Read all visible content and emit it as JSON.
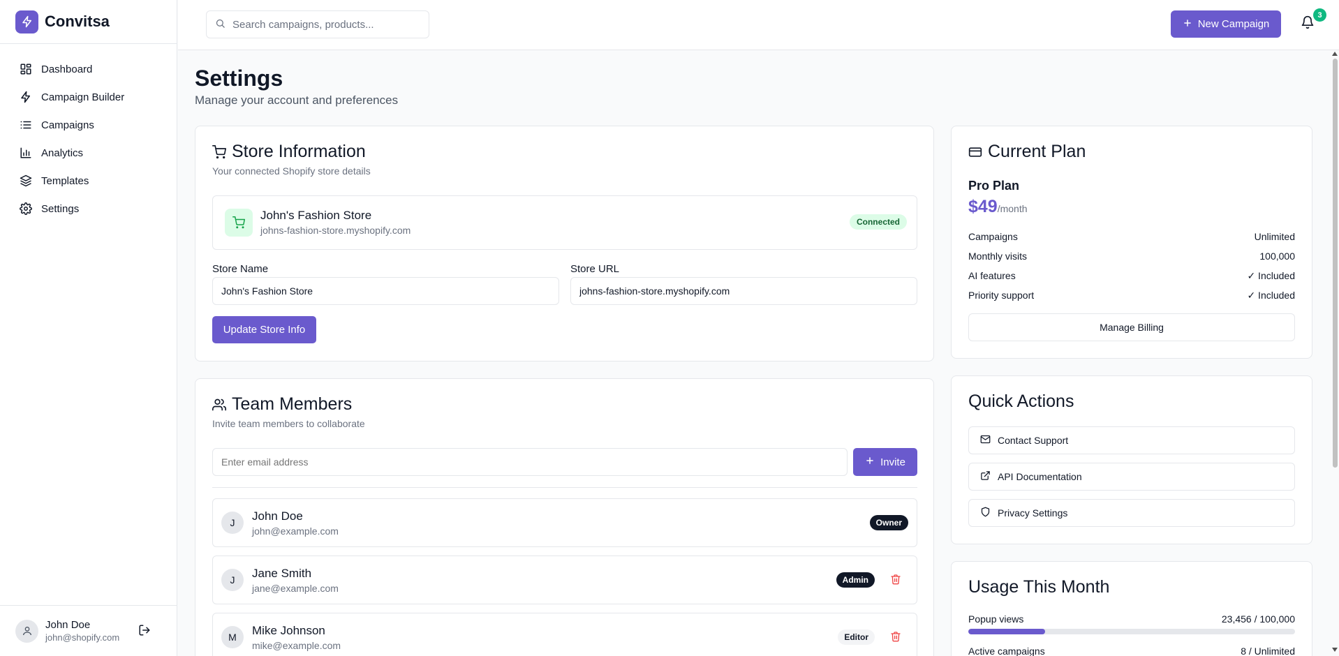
{
  "brand": {
    "name": "Convitsa"
  },
  "sidebar": {
    "items": [
      {
        "label": "Dashboard",
        "icon": "dashboard-icon"
      },
      {
        "label": "Campaign Builder",
        "icon": "lightning-icon"
      },
      {
        "label": "Campaigns",
        "icon": "list-icon"
      },
      {
        "label": "Analytics",
        "icon": "bar-chart-icon"
      },
      {
        "label": "Templates",
        "icon": "layers-icon"
      },
      {
        "label": "Settings",
        "icon": "gear-icon"
      }
    ],
    "user": {
      "name": "John Doe",
      "email": "john@shopify.com"
    }
  },
  "topbar": {
    "search_placeholder": "Search campaigns, products...",
    "new_campaign_label": "New Campaign",
    "notification_count": "3"
  },
  "page": {
    "title": "Settings",
    "subtitle": "Manage your account and preferences"
  },
  "store": {
    "title": "Store Information",
    "subtitle": "Your connected Shopify store details",
    "connected_name": "John's Fashion Store",
    "connected_url": "johns-fashion-store.myshopify.com",
    "status": "Connected",
    "name_label": "Store Name",
    "name_value": "John's Fashion Store",
    "url_label": "Store URL",
    "url_value": "johns-fashion-store.myshopify.com",
    "update_label": "Update Store Info"
  },
  "team": {
    "title": "Team Members",
    "subtitle": "Invite team members to collaborate",
    "email_placeholder": "Enter email address",
    "invite_label": "Invite",
    "members": [
      {
        "initial": "J",
        "name": "John Doe",
        "email": "john@example.com",
        "role": "Owner"
      },
      {
        "initial": "J",
        "name": "Jane Smith",
        "email": "jane@example.com",
        "role": "Admin"
      },
      {
        "initial": "M",
        "name": "Mike Johnson",
        "email": "mike@example.com",
        "role": "Editor"
      }
    ]
  },
  "plan": {
    "title": "Current Plan",
    "name": "Pro Plan",
    "price": "$49",
    "period": "/month",
    "rows": [
      {
        "label": "Campaigns",
        "value": "Unlimited"
      },
      {
        "label": "Monthly visits",
        "value": "100,000"
      },
      {
        "label": "AI features",
        "value": "✓ Included"
      },
      {
        "label": "Priority support",
        "value": "✓ Included"
      }
    ],
    "billing_label": "Manage Billing"
  },
  "quick_actions": {
    "title": "Quick Actions",
    "items": [
      {
        "label": "Contact Support",
        "icon": "mail-icon"
      },
      {
        "label": "API Documentation",
        "icon": "external-link-icon"
      },
      {
        "label": "Privacy Settings",
        "icon": "shield-icon"
      }
    ]
  },
  "usage": {
    "title": "Usage This Month",
    "rows": [
      {
        "label": "Popup views",
        "value": "23,456 / 100,000",
        "fraction": 0.23456
      },
      {
        "label": "Active campaigns",
        "value": "8 / Unlimited"
      }
    ]
  },
  "colors": {
    "accent": "#6a5acd",
    "success": "#10b981",
    "danger": "#ef4444"
  }
}
